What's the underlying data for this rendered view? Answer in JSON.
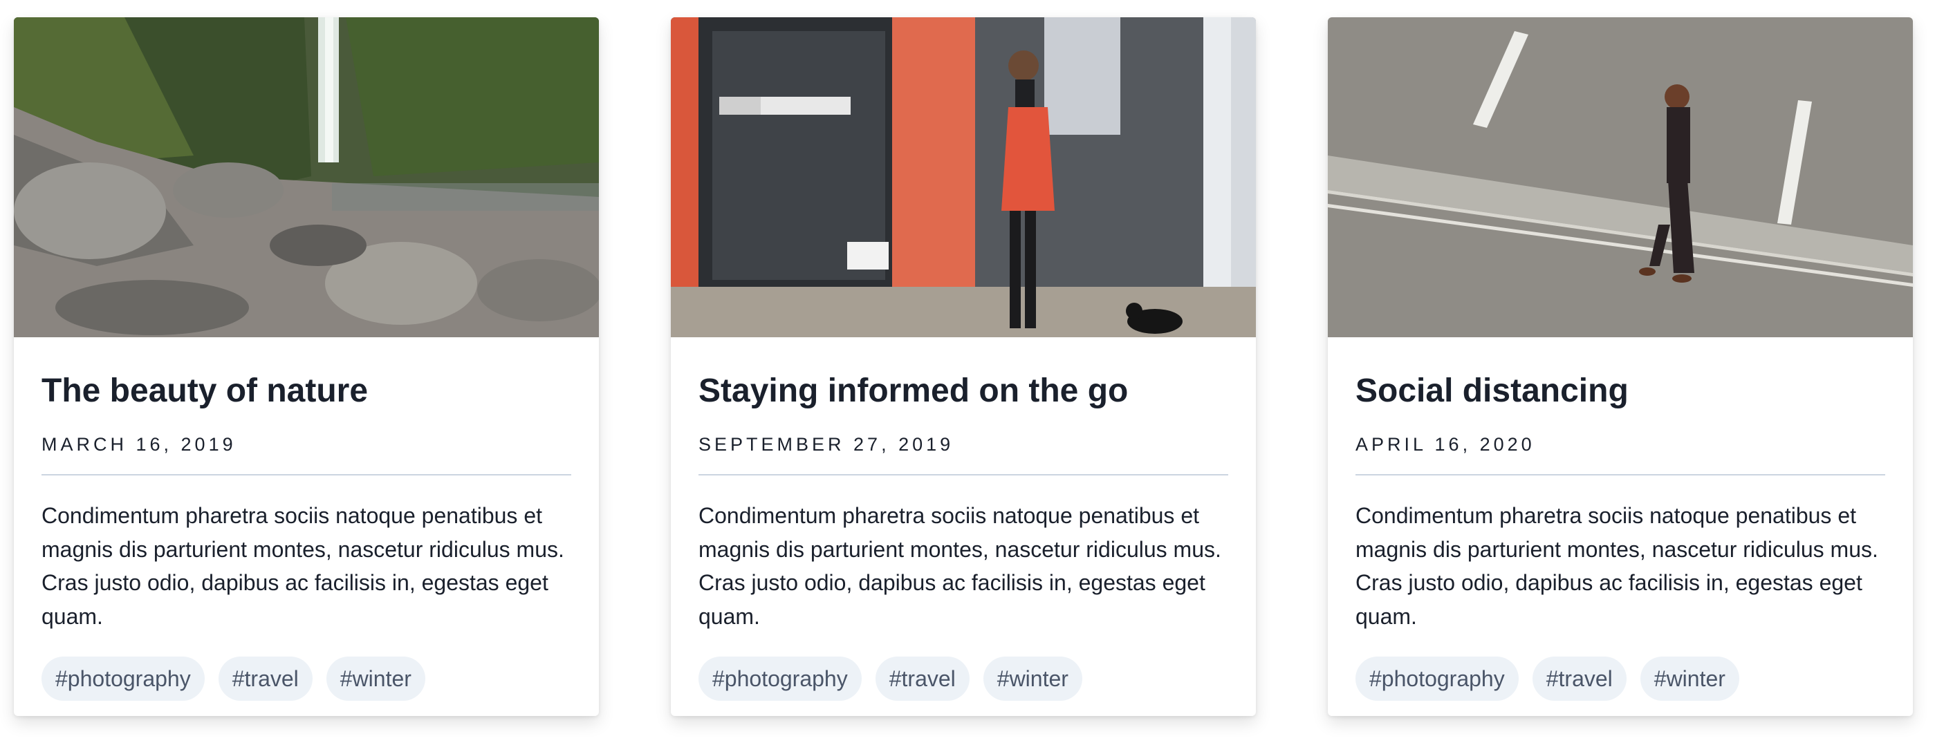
{
  "cards": [
    {
      "image": "waterfall-nature-photo",
      "title": "The beauty of nature",
      "date": "MARCH 16, 2019",
      "text": "Condimentum pharetra sociis natoque penatibus et magnis dis parturient montes, nascetur ridiculus mus. Cras justo odio, dapibus ac facilisis in, egestas eget quam.",
      "tags": [
        "#photography",
        "#travel",
        "#winter"
      ]
    },
    {
      "image": "woman-phone-storefront-photo",
      "title": "Staying informed on the go",
      "date": "SEPTEMBER 27, 2019",
      "text": "Condimentum pharetra sociis natoque penatibus et magnis dis parturient montes, nascetur ridiculus mus. Cras justo odio, dapibus ac facilisis in, egestas eget quam.",
      "tags": [
        "#photography",
        "#travel",
        "#winter"
      ]
    },
    {
      "image": "man-walking-street-photo",
      "title": "Social distancing",
      "date": "APRIL 16, 2020",
      "text": "Condimentum pharetra sociis natoque penatibus et magnis dis parturient montes, nascetur ridiculus mus. Cras justo odio, dapibus ac facilisis in, egestas eget quam.",
      "tags": [
        "#photography",
        "#travel",
        "#winter"
      ]
    }
  ],
  "colors": {
    "title": "#1a202c",
    "tag_bg": "#edf2f7",
    "tag_text": "#4a5568",
    "divider": "#cbd5e0"
  }
}
